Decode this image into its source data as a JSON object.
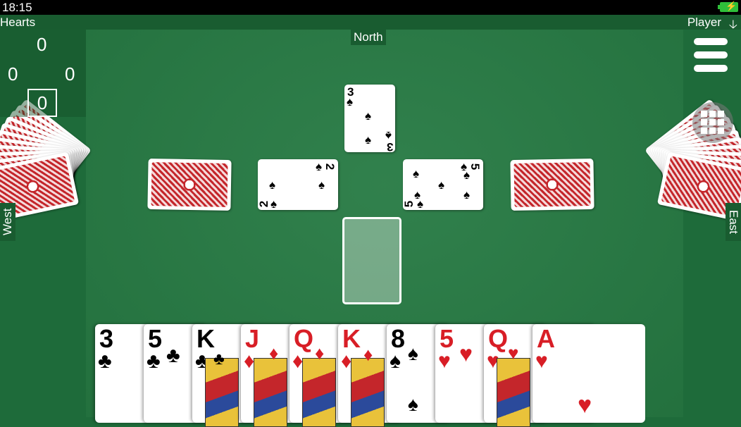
{
  "status": {
    "time": "18:15",
    "battery_icon": "battery-charging-icon"
  },
  "header": {
    "title": "Hearts",
    "player_label": "Player",
    "arrow": "🡣"
  },
  "seats": {
    "north": "North",
    "west": "West",
    "east": "East"
  },
  "scores": {
    "north": "0",
    "west": "0",
    "east": "0",
    "mine": "0"
  },
  "trick": [
    {
      "seat": "north",
      "rank": "3",
      "suit": "♠",
      "color": "#000000"
    },
    {
      "seat": "west",
      "rank": "2",
      "suit": "♠",
      "color": "#000000"
    },
    {
      "seat": "east",
      "rank": "5",
      "suit": "♠",
      "color": "#000000"
    }
  ],
  "hand": [
    {
      "rank": "3",
      "suit": "♣",
      "color": "#000000"
    },
    {
      "rank": "5",
      "suit": "♣",
      "color": "#000000"
    },
    {
      "rank": "K",
      "suit": "♣",
      "color": "#000000"
    },
    {
      "rank": "J",
      "suit": "♦",
      "color": "#d81e26"
    },
    {
      "rank": "Q",
      "suit": "♦",
      "color": "#d81e26"
    },
    {
      "rank": "K",
      "suit": "♦",
      "color": "#d81e26"
    },
    {
      "rank": "8",
      "suit": "♠",
      "color": "#000000"
    },
    {
      "rank": "5",
      "suit": "♥",
      "color": "#d81e26"
    },
    {
      "rank": "Q",
      "suit": "♥",
      "color": "#d81e26"
    },
    {
      "rank": "A",
      "suit": "♥",
      "color": "#d81e26"
    }
  ],
  "colors": {
    "felt": "#267a43",
    "card_back": "#c4262b"
  }
}
